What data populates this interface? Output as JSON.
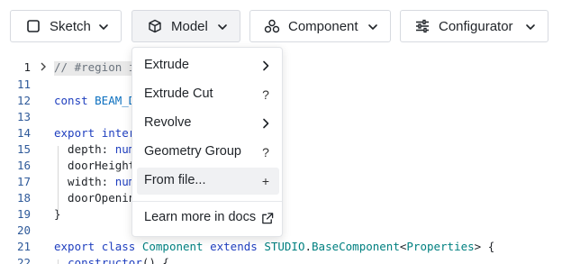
{
  "toolbar": {
    "buttons": [
      {
        "label": "Sketch",
        "icon": "square-icon"
      },
      {
        "label": "Model",
        "icon": "cube-icon"
      },
      {
        "label": "Component",
        "icon": "components-icon"
      },
      {
        "label": "Configurator",
        "icon": "sliders-icon"
      }
    ]
  },
  "editor": {
    "lines": [
      {
        "num": "1",
        "parts": [
          [
            "cm",
            "// #region i"
          ]
        ]
      },
      {
        "num": "11",
        "parts": []
      },
      {
        "num": "12",
        "parts": [
          [
            "kw",
            "const "
          ],
          [
            "cn",
            "BEAM_D"
          ]
        ]
      },
      {
        "num": "13",
        "parts": []
      },
      {
        "num": "14",
        "parts": [
          [
            "kw",
            "export "
          ],
          [
            "kw",
            "inter"
          ]
        ]
      },
      {
        "num": "15",
        "parts": [
          [
            "",
            "  depth: "
          ],
          [
            "kw",
            "num"
          ]
        ]
      },
      {
        "num": "16",
        "parts": [
          [
            "",
            "  doorHeight"
          ]
        ]
      },
      {
        "num": "17",
        "parts": [
          [
            "",
            "  width: "
          ],
          [
            "kw",
            "num"
          ]
        ]
      },
      {
        "num": "18",
        "parts": [
          [
            "",
            "  doorOpenin"
          ]
        ]
      },
      {
        "num": "19",
        "parts": [
          [
            "",
            "}"
          ]
        ]
      },
      {
        "num": "20",
        "parts": []
      },
      {
        "num": "21",
        "parts": [
          [
            "kw",
            "export "
          ],
          [
            "kw",
            "class "
          ],
          [
            "ty",
            "Component "
          ],
          [
            "kw",
            "extends "
          ],
          [
            "ty",
            "STUDIO"
          ],
          [
            "",
            "."
          ],
          [
            "ty",
            "BaseComponent"
          ],
          [
            "",
            "<"
          ],
          [
            "ty",
            "Properties"
          ],
          [
            "",
            "> {"
          ]
        ]
      },
      {
        "num": "22",
        "parts": [
          [
            "",
            "  "
          ],
          [
            "kw",
            "constructor"
          ],
          [
            "",
            "() {"
          ]
        ]
      }
    ]
  },
  "menu": {
    "items": [
      {
        "label": "Extrude",
        "icon": "chevron-right-icon",
        "glyph": ""
      },
      {
        "label": "Extrude Cut",
        "icon": "question-icon",
        "glyph": "?"
      },
      {
        "label": "Revolve",
        "icon": "chevron-right-icon",
        "glyph": ""
      },
      {
        "label": "Geometry Group",
        "icon": "question-icon",
        "glyph": "?"
      },
      {
        "label": "From file...",
        "icon": "plus-icon",
        "glyph": "+"
      }
    ],
    "footer": {
      "label": "Learn more in docs",
      "icon": "external-link-icon"
    }
  }
}
